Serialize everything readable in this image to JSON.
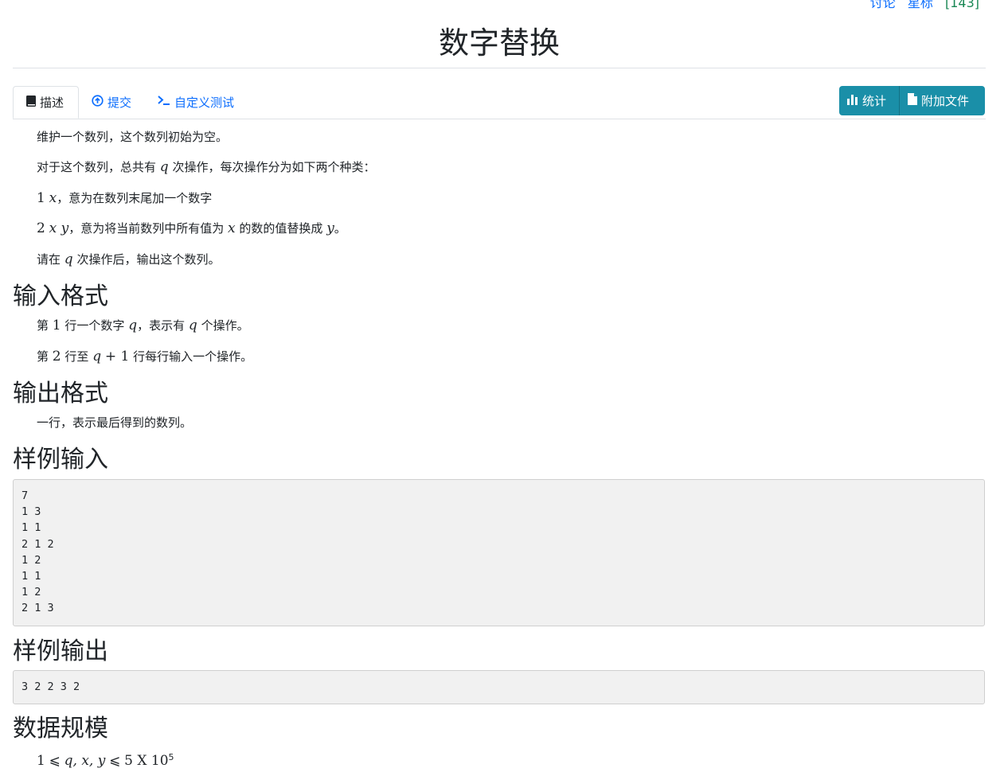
{
  "header": {
    "link_discuss": "讨论",
    "link_star": "星标",
    "count_label": "[143]",
    "title": "数字替换"
  },
  "tabs": [
    {
      "label": "描述",
      "icon": "book-icon",
      "active": true
    },
    {
      "label": "提交",
      "icon": "upload-circle-icon",
      "active": false
    },
    {
      "label": "自定义测试",
      "icon": "terminal-icon",
      "active": false
    }
  ],
  "actions": {
    "stats_label": "统计",
    "files_label": "附加文件",
    "color": "#1a8fa8"
  },
  "description": {
    "p1": "维护一个数列，这个数列初始为空。",
    "p2_a": "对于这个数列，总共有",
    "p2_var": "q",
    "p2_b": "次操作，每次操作分为如下两个种类：",
    "p3_num": "1",
    "p3_var": "x",
    "p3_b": "，意为在数列末尾加一个数字",
    "p4_num": "2",
    "p4_vars": "x y",
    "p4_b": "，意为将当前数列中所有值为",
    "p4_var2": "x",
    "p4_c": "的数的值替换成",
    "p4_var3": "y",
    "p4_d": "。",
    "p5_a": "请在",
    "p5_var": "q",
    "p5_b": "次操作后，输出这个数列。"
  },
  "input_format": {
    "heading": "输入格式",
    "l1_a": "第",
    "l1_num": "1",
    "l1_b": "行一个数字",
    "l1_var": "q",
    "l1_c": "，表示有",
    "l1_var2": "q",
    "l1_d": "个操作。",
    "l2_a": "第",
    "l2_num": "2",
    "l2_b": "行至",
    "l2_var": "q",
    "l2_plus": "+ 1",
    "l2_c": "行每行输入一个操作。"
  },
  "output_format": {
    "heading": "输出格式",
    "text": "一行，表示最后得到的数列。"
  },
  "sample_input": {
    "heading": "样例输入",
    "content": "7\n1 3\n1 1\n2 1 2\n1 2\n1 1\n1 2\n2 1 3"
  },
  "sample_output": {
    "heading": "样例输出",
    "content": "3 2 2 3 2"
  },
  "constraints": {
    "heading": "数据规模",
    "one": "1",
    "le1": "⩽",
    "vars": "q, x, y",
    "le2": "⩽",
    "rhs": "5 X 10",
    "exp": "5"
  }
}
